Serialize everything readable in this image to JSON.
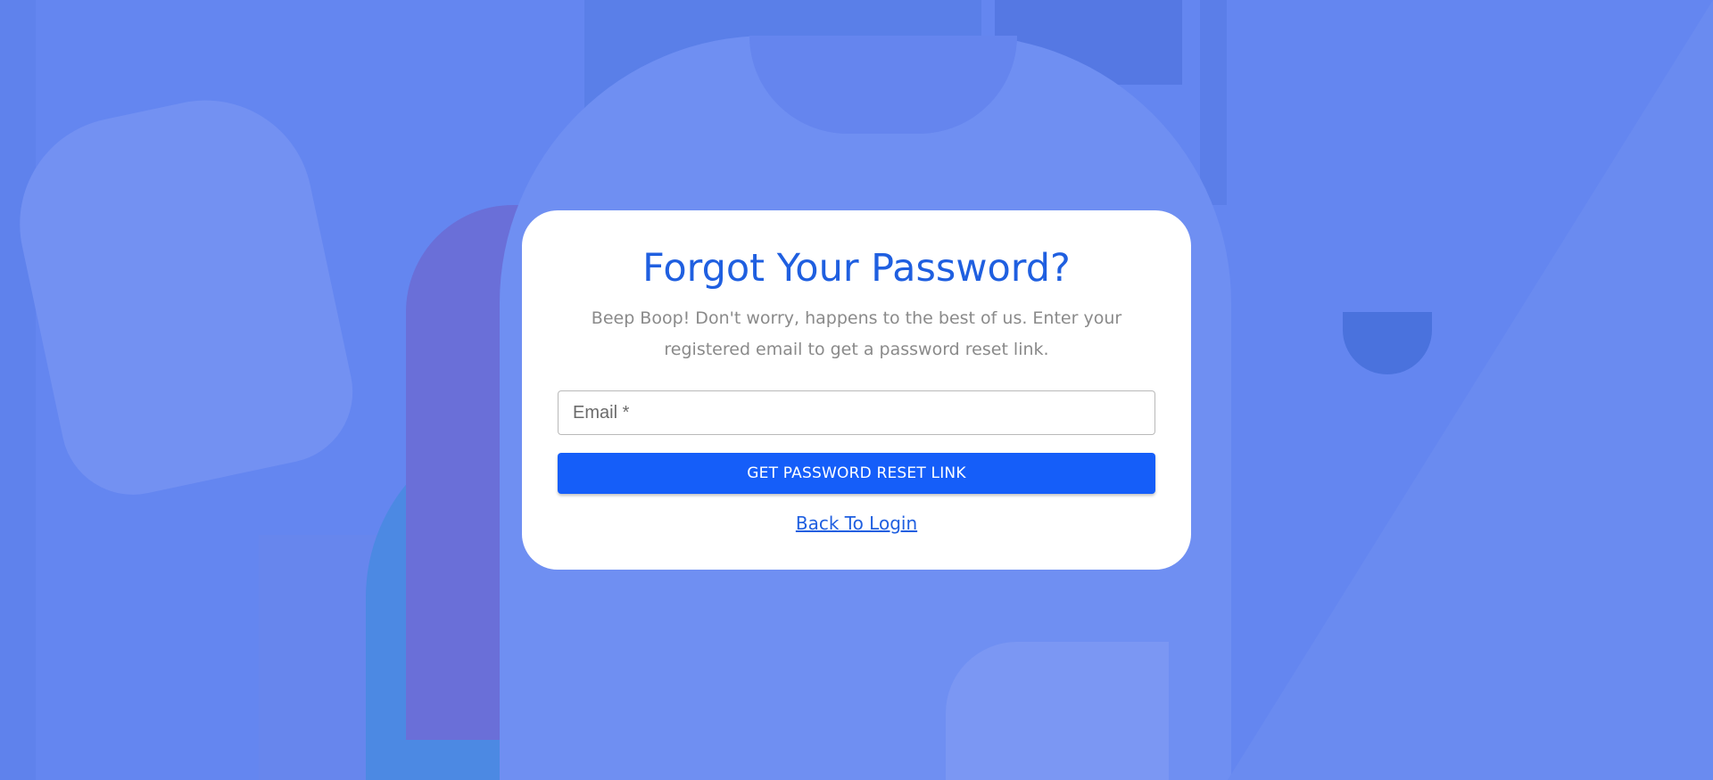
{
  "page": {
    "overlay_color": "#6486f0",
    "accent_color": "#155ef9"
  },
  "card": {
    "title": "Forgot Your Password?",
    "subtitle": "Beep Boop! Don't worry, happens to the best of us. Enter your registered email to get a password reset link.",
    "email": {
      "placeholder": "Email *",
      "value": ""
    },
    "submit_label": "GET PASSWORD RESET LINK",
    "back_link_label": "Back To Login"
  }
}
